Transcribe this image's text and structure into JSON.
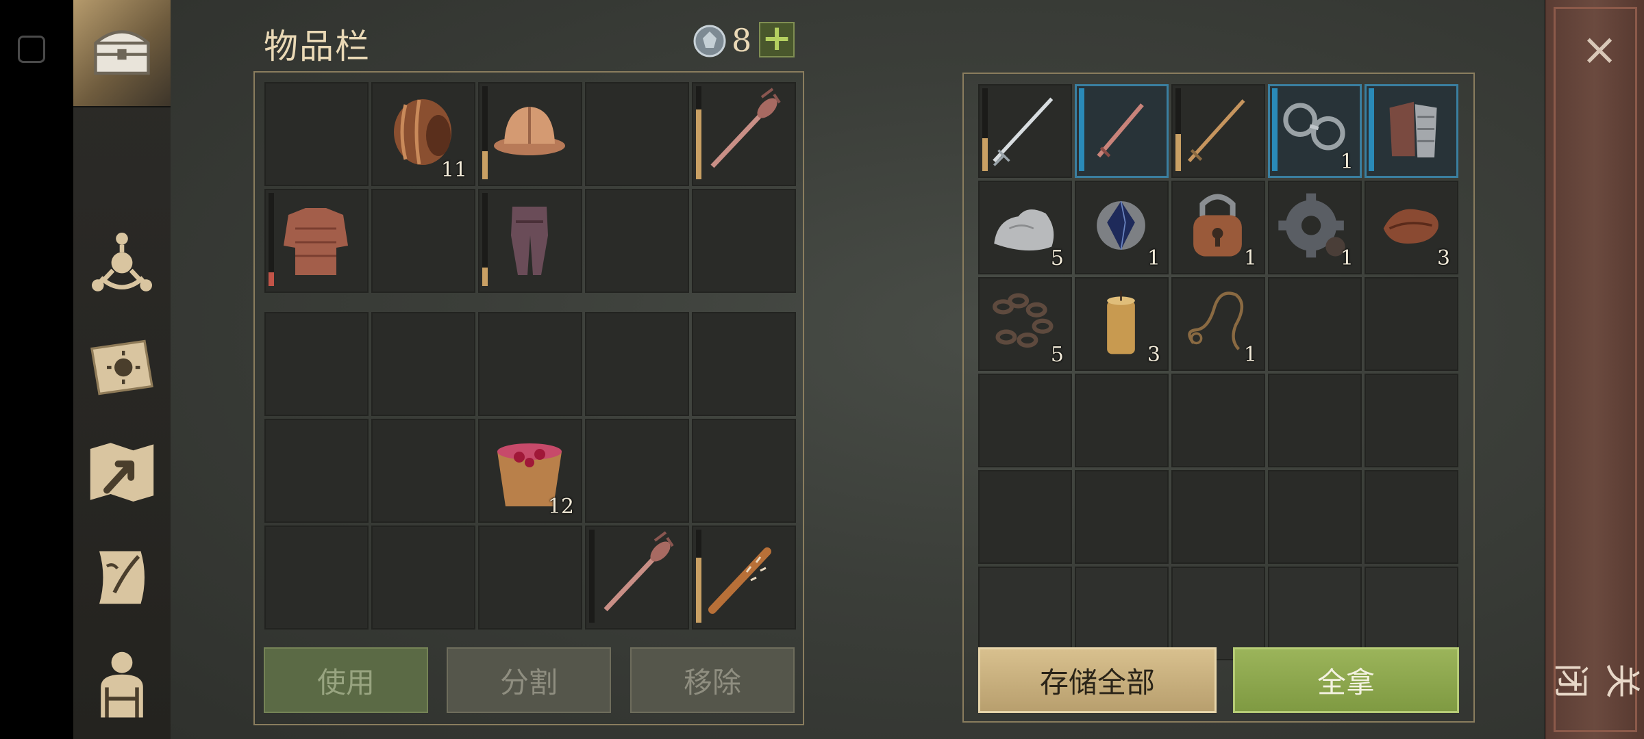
{
  "header": {
    "title": "物品栏",
    "currency_value": "8",
    "currency_icon": "gem-coin-icon",
    "add_label": "+"
  },
  "sidebar": {
    "items": [
      {
        "name": "chest-icon",
        "active": true
      },
      {
        "name": "clan-emblem-icon",
        "active": false
      },
      {
        "name": "sun-book-icon",
        "active": false
      },
      {
        "name": "map-arrow-icon",
        "active": false
      },
      {
        "name": "scroll-quill-icon",
        "active": false
      },
      {
        "name": "character-backpack-icon",
        "active": false
      }
    ]
  },
  "inventory": {
    "equipment": [
      {
        "item": "empty"
      },
      {
        "item": "barrel",
        "qty": "11"
      },
      {
        "item": "helmet",
        "durability": 0.3,
        "bar_color": "#c9a064"
      },
      {
        "item": "empty"
      },
      {
        "item": "mace",
        "durability": 0.75,
        "bar_color": "#c9a064"
      },
      {
        "item": "chainmail",
        "durability": 0.15,
        "bar_color": "#c25448"
      },
      {
        "item": "empty"
      },
      {
        "item": "pants",
        "durability": 0.2,
        "bar_color": "#c9a064"
      },
      {
        "item": "empty"
      },
      {
        "item": "empty"
      }
    ],
    "backpack": [
      {
        "item": "empty"
      },
      {
        "item": "empty"
      },
      {
        "item": "empty"
      },
      {
        "item": "empty"
      },
      {
        "item": "empty"
      },
      {
        "item": "empty"
      },
      {
        "item": "empty"
      },
      {
        "item": "berry-bucket",
        "qty": "12"
      },
      {
        "item": "empty"
      },
      {
        "item": "empty"
      },
      {
        "item": "empty"
      },
      {
        "item": "empty"
      },
      {
        "item": "empty"
      },
      {
        "item": "mace",
        "durability": 0.0,
        "bar_color": "#c9a064"
      },
      {
        "item": "spiked-club",
        "durability": 0.7,
        "bar_color": "#c9a064"
      }
    ],
    "actions": {
      "use": "使用",
      "split": "分割",
      "remove": "移除"
    }
  },
  "storage": {
    "cells": [
      {
        "item": "longsword",
        "durability": 0.4,
        "bar_color": "#c9a064"
      },
      {
        "item": "dagger",
        "highlight": true
      },
      {
        "item": "wooden-sword",
        "durability": 0.45,
        "bar_color": "#c9a064"
      },
      {
        "item": "shackles",
        "qty": "1",
        "highlight": true
      },
      {
        "item": "gauntlets",
        "highlight": true
      },
      {
        "item": "stone",
        "qty": "5"
      },
      {
        "item": "crystal",
        "qty": "1"
      },
      {
        "item": "padlock",
        "qty": "1"
      },
      {
        "item": "gear",
        "qty": "1"
      },
      {
        "item": "leather",
        "qty": "3"
      },
      {
        "item": "chain",
        "qty": "5"
      },
      {
        "item": "candle",
        "qty": "3"
      },
      {
        "item": "rope",
        "qty": "1"
      },
      {
        "item": "empty"
      },
      {
        "item": "empty"
      },
      {
        "item": "empty"
      },
      {
        "item": "empty"
      },
      {
        "item": "empty"
      },
      {
        "item": "empty"
      },
      {
        "item": "empty"
      },
      {
        "item": "empty"
      },
      {
        "item": "empty"
      },
      {
        "item": "empty"
      },
      {
        "item": "empty"
      },
      {
        "item": "empty"
      },
      {
        "item": "empty",
        "dim": true
      },
      {
        "item": "empty",
        "dim": true
      },
      {
        "item": "empty",
        "dim": true
      },
      {
        "item": "empty",
        "dim": true
      },
      {
        "item": "empty",
        "dim": true
      }
    ],
    "actions": {
      "store_all": "存储全部",
      "take_all": "全拿"
    }
  },
  "close": {
    "label": "关闭",
    "x_icon": "×"
  },
  "colors": {
    "accent_gold": "#d8c08e",
    "accent_green": "#9bb45a",
    "highlight_blue": "#3a7fa0",
    "close_panel": "#6b4a3f"
  }
}
